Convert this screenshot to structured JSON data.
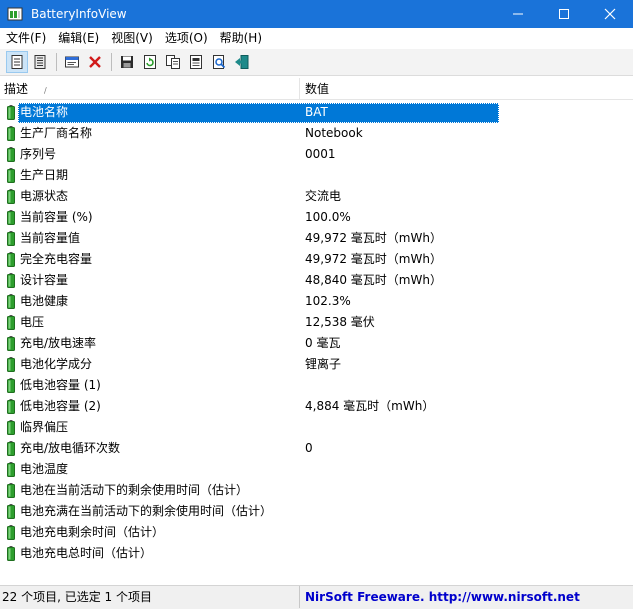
{
  "window": {
    "title": "BatteryInfoView",
    "min_glyph": "—",
    "max_glyph": "☐",
    "close_glyph": "✕"
  },
  "menu": [
    {
      "label": "文件(F)"
    },
    {
      "label": "编辑(E)"
    },
    {
      "label": "视图(V)"
    },
    {
      "label": "选项(O)"
    },
    {
      "label": "帮助(H)"
    }
  ],
  "toolbar": {
    "buttons": [
      "battery-info-view-icon",
      "log-view-icon",
      "properties-icon",
      "clear-delete-icon",
      "save-icon",
      "refresh-icon",
      "copy-icon",
      "html-report-icon",
      "find-icon",
      "exit-icon"
    ]
  },
  "columns": {
    "description": "描述",
    "value": "数值"
  },
  "rows": [
    {
      "desc": "电池名称",
      "val": "BAT"
    },
    {
      "desc": "生产厂商名称",
      "val": "Notebook"
    },
    {
      "desc": "序列号",
      "val": "0001"
    },
    {
      "desc": "生产日期",
      "val": ""
    },
    {
      "desc": "电源状态",
      "val": "交流电"
    },
    {
      "desc": "当前容量 (%)",
      "val": "100.0%"
    },
    {
      "desc": "当前容量值",
      "val": "49,972 毫瓦时（mWh）"
    },
    {
      "desc": "完全充电容量",
      "val": "49,972 毫瓦时（mWh）"
    },
    {
      "desc": "设计容量",
      "val": "48,840 毫瓦时（mWh）"
    },
    {
      "desc": "电池健康",
      "val": "102.3%"
    },
    {
      "desc": "电压",
      "val": "12,538 毫伏"
    },
    {
      "desc": "充电/放电速率",
      "val": "0 毫瓦"
    },
    {
      "desc": "电池化学成分",
      "val": "锂离子"
    },
    {
      "desc": "低电池容量 (1)",
      "val": ""
    },
    {
      "desc": "低电池容量 (2)",
      "val": "4,884 毫瓦时（mWh）"
    },
    {
      "desc": "临界偏压",
      "val": ""
    },
    {
      "desc": "充电/放电循环次数",
      "val": "0"
    },
    {
      "desc": "电池温度",
      "val": ""
    },
    {
      "desc": "电池在当前活动下的剩余使用时间（估计）",
      "val": ""
    },
    {
      "desc": "电池充满在当前活动下的剩余使用时间（估计）",
      "val": ""
    },
    {
      "desc": "电池充电剩余时间（估计）",
      "val": ""
    },
    {
      "desc": "电池充电总时间（估计）",
      "val": ""
    }
  ],
  "status": {
    "left": "22 个项目, 已选定 1 个项目",
    "right": "NirSoft Freeware.  http://www.nirsoft.net"
  },
  "colors": {
    "titlebar": "#1a73d9",
    "selection": "#0078d7",
    "battery_green": "#2e9e2e",
    "link": "#0000cc"
  }
}
